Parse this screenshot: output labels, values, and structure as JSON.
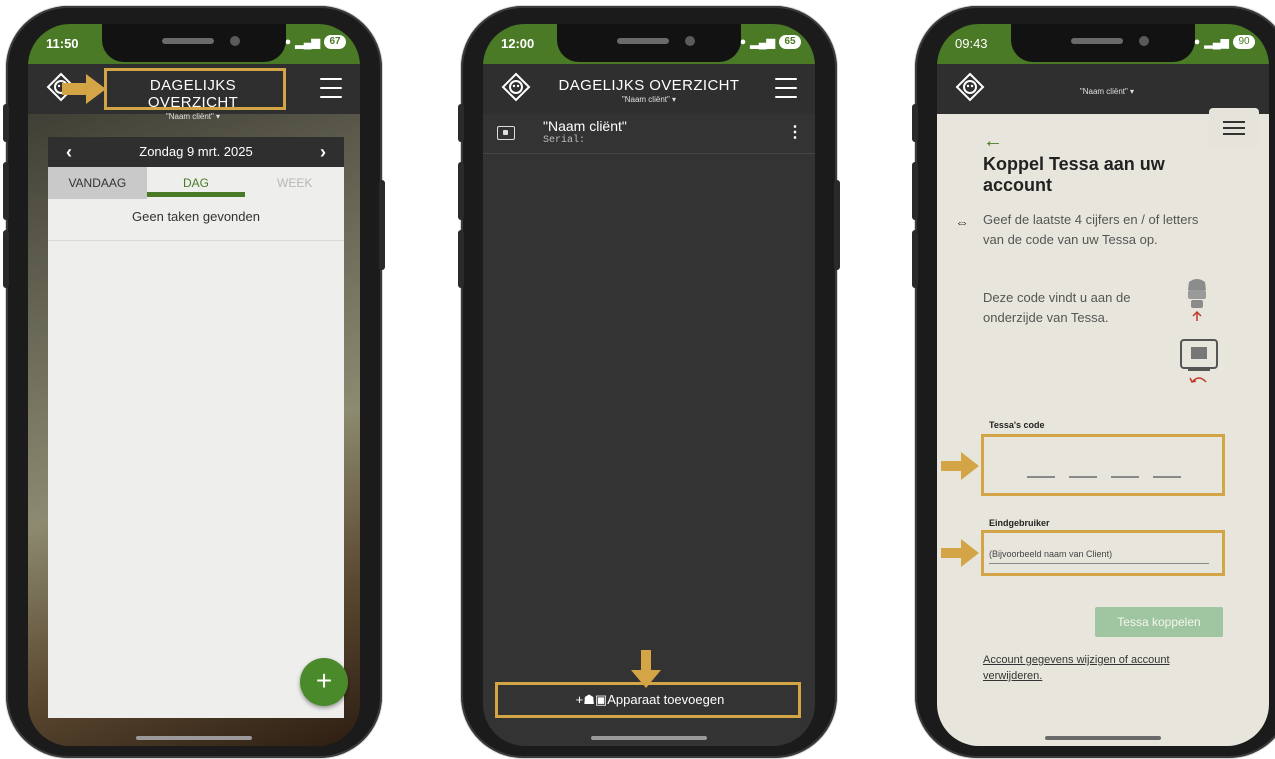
{
  "colors": {
    "app_green": "#4a7a25",
    "app_bar": "#2f2f2f",
    "highlight": "#d4a546",
    "fab_green": "#4a8a2a",
    "button_disabled": "#9fc6a0",
    "page_beige": "#e8e6dc"
  },
  "phone1": {
    "status_time": "11:50",
    "battery": "67",
    "title": "DAGELIJKS OVERZICHT",
    "subtitle": "\"Naam cliënt\"",
    "date_label": "Zondag 9 mrt. 2025",
    "prev_icon": "chevron-left-icon",
    "next_icon": "chevron-right-icon",
    "tabs": [
      "VANDAAG",
      "DAG",
      "WEEK"
    ],
    "active_tab": "DAG",
    "empty_message": "Geen taken gevonden",
    "fab_label": "+"
  },
  "phone2": {
    "status_time": "12:00",
    "battery": "65",
    "title": "DAGELIJKS OVERZICHT",
    "subtitle": "\"Naam cliënt\"",
    "device_name": "\"Naam cliënt\"",
    "device_serial_label": "Serial:",
    "more_icon": "⋮",
    "add_device_prefix": "+",
    "add_device_label": "Apparaat toevoegen"
  },
  "phone3": {
    "status_time": "09:43",
    "battery": "90",
    "subtitle": "\"Naam cliënt\"",
    "back_icon": "←",
    "title": "Koppel Tessa aan uw account",
    "link_icon": "⇔",
    "description_1": "Geef de laatste 4 cijfers en / of letters van de code van uw Tessa op.",
    "description_2": "Deze code vindt u aan de onderzijde van Tessa.",
    "code_label": "Tessa's code",
    "end_user_label": "Eindgebruiker",
    "end_user_placeholder": "(Bijvoorbeeld naam van Client)",
    "submit_label": "Tessa koppelen",
    "account_link": "Account gegevens wijzigen of account verwijderen."
  }
}
